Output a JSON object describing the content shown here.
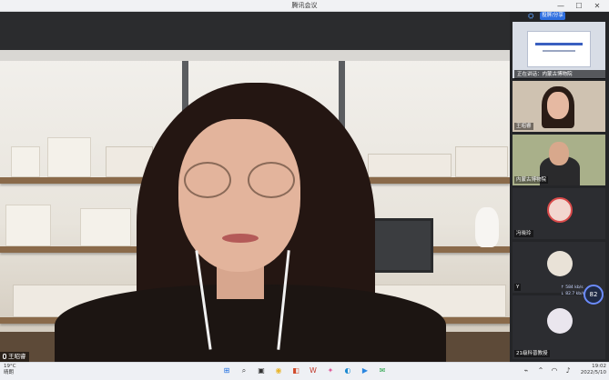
{
  "window": {
    "title": "腾讯会议",
    "minimize": "—",
    "maximize": "☐",
    "close": "✕"
  },
  "toolbar": {
    "share_label": "投屏/分享"
  },
  "main_speaker": {
    "name": "王昭睿"
  },
  "screen_share": {
    "title": "正在讲话：内蒙古博物院"
  },
  "participants": [
    {
      "name": "王昭睿"
    },
    {
      "name": "内蒙古博物院"
    },
    {
      "name": "冯晓玲"
    },
    {
      "name": "Y"
    },
    {
      "name": "21级科普教授"
    }
  ],
  "network": {
    "score": "82",
    "up": "↑ 584 kb/s",
    "down": "↓ 82.7 kb/s"
  },
  "taskbar": {
    "weather_temp": "19°C",
    "weather_desc": "晴朗",
    "time": "19:02",
    "date": "2022/5/10"
  },
  "colors": {
    "accent": "#2f6fe0",
    "sidebar_bg": "#242528",
    "taskbar_bg": "#eef0f4"
  }
}
